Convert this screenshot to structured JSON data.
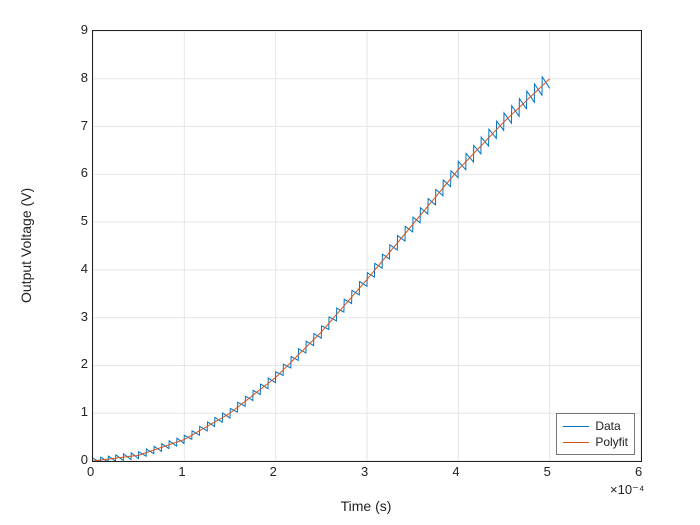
{
  "chart_data": {
    "type": "line",
    "title": "",
    "xlabel": "Time (s)",
    "ylabel": "Output Voltage (V)",
    "xlim": [
      0,
      0.0006
    ],
    "ylim": [
      0,
      9
    ],
    "x_exponent_label": "×10⁻⁴",
    "xticks": [
      0,
      1,
      2,
      3,
      4,
      5,
      6
    ],
    "yticks": [
      0,
      1,
      2,
      3,
      4,
      5,
      6,
      7,
      8,
      9
    ],
    "grid": true,
    "series": [
      {
        "name": "Data",
        "color": "#0072BD",
        "description": "Oscillating sawtooth-like signal riding on rising curve; x from 0 to 5e-4 s, envelope ~±0.2 V around Polyfit curve",
        "x_range_e4": [
          0,
          5
        ],
        "n_cycles": 60,
        "osc_amplitude": 0.2,
        "envelope_matches": "Polyfit"
      },
      {
        "name": "Polyfit",
        "color": "#D95319",
        "x_e4": [
          0.0,
          0.5,
          1.0,
          1.5,
          2.0,
          2.5,
          3.0,
          3.5,
          4.0,
          4.5,
          5.0
        ],
        "y": [
          0.0,
          0.12,
          0.45,
          1.0,
          1.75,
          2.7,
          3.8,
          4.95,
          6.1,
          7.1,
          8.0
        ]
      }
    ],
    "legend": {
      "position": "lower-right",
      "entries": [
        "Data",
        "Polyfit"
      ]
    },
    "colors": {
      "axis": "#222222",
      "grid": "#e6e6e6",
      "series1": "#0072BD",
      "series2": "#D95319"
    }
  }
}
